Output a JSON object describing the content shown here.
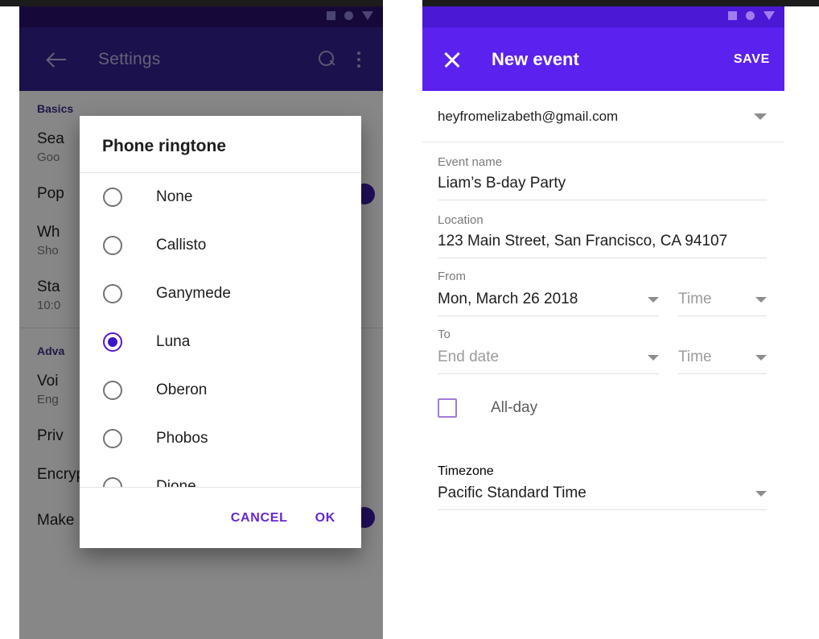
{
  "left_phone": {
    "status_icons": [
      "square-icon",
      "circle-icon",
      "triangle-down-icon"
    ],
    "appbar": {
      "back_icon": "arrow-left-icon",
      "title": "Settings",
      "search_icon": "search-icon",
      "overflow_icon": "more-vertical-icon"
    },
    "settings": {
      "section_basics": "Basics",
      "items": [
        {
          "title": "Sea",
          "subtitle": "Goo"
        },
        {
          "title": "Pop",
          "subtitle": ""
        },
        {
          "title": "Wh",
          "subtitle": "Sho"
        },
        {
          "title": "Sta",
          "subtitle": "10:0"
        }
      ],
      "section_advanced": "Adva",
      "items2": [
        {
          "title": "Voi",
          "subtitle": "Eng"
        },
        {
          "title": "Priv",
          "subtitle": ""
        },
        {
          "title": "Encryption",
          "subtitle": ""
        },
        {
          "title": "Make passwords visible",
          "subtitle": ""
        }
      ]
    },
    "dialog": {
      "title": "Phone ringtone",
      "options": [
        {
          "label": "None",
          "selected": false
        },
        {
          "label": "Callisto",
          "selected": false
        },
        {
          "label": "Ganymede",
          "selected": false
        },
        {
          "label": "Luna",
          "selected": true
        },
        {
          "label": "Oberon",
          "selected": false
        },
        {
          "label": "Phobos",
          "selected": false
        },
        {
          "label": "Dione",
          "selected": false
        }
      ],
      "cancel_label": "CANCEL",
      "ok_label": "OK"
    }
  },
  "right_phone": {
    "status_icons": [
      "square-icon",
      "circle-icon",
      "triangle-down-icon"
    ],
    "appbar": {
      "close_icon": "close-icon",
      "title": "New event",
      "save_label": "SAVE"
    },
    "account": {
      "email": "heyfromelizabeth@gmail.com",
      "dropdown_icon": "chevron-down-icon"
    },
    "form": {
      "event_name_label": "Event name",
      "event_name_value": "Liam’s B-day Party",
      "location_label": "Location",
      "location_value": "123 Main Street, San Francisco, CA 94107",
      "from_label": "From",
      "from_date_value": "Mon, March 26 2018",
      "from_time_placeholder": "Time",
      "to_label": "To",
      "to_date_placeholder": "End date",
      "to_time_placeholder": "Time",
      "allday_label": "All-day",
      "allday_checked": false,
      "timezone_label": "Timezone",
      "timezone_value": "Pacific Standard Time"
    }
  },
  "colors": {
    "left_appbar": "#32208e",
    "left_statusbar": "#2a1269",
    "right_appbar": "#5b21ee",
    "right_statusbar": "#4b18d6",
    "accent": "#6526d4",
    "radio_selected": "#3a16c4",
    "scrim": "rgba(0,0,0,0.46)"
  }
}
